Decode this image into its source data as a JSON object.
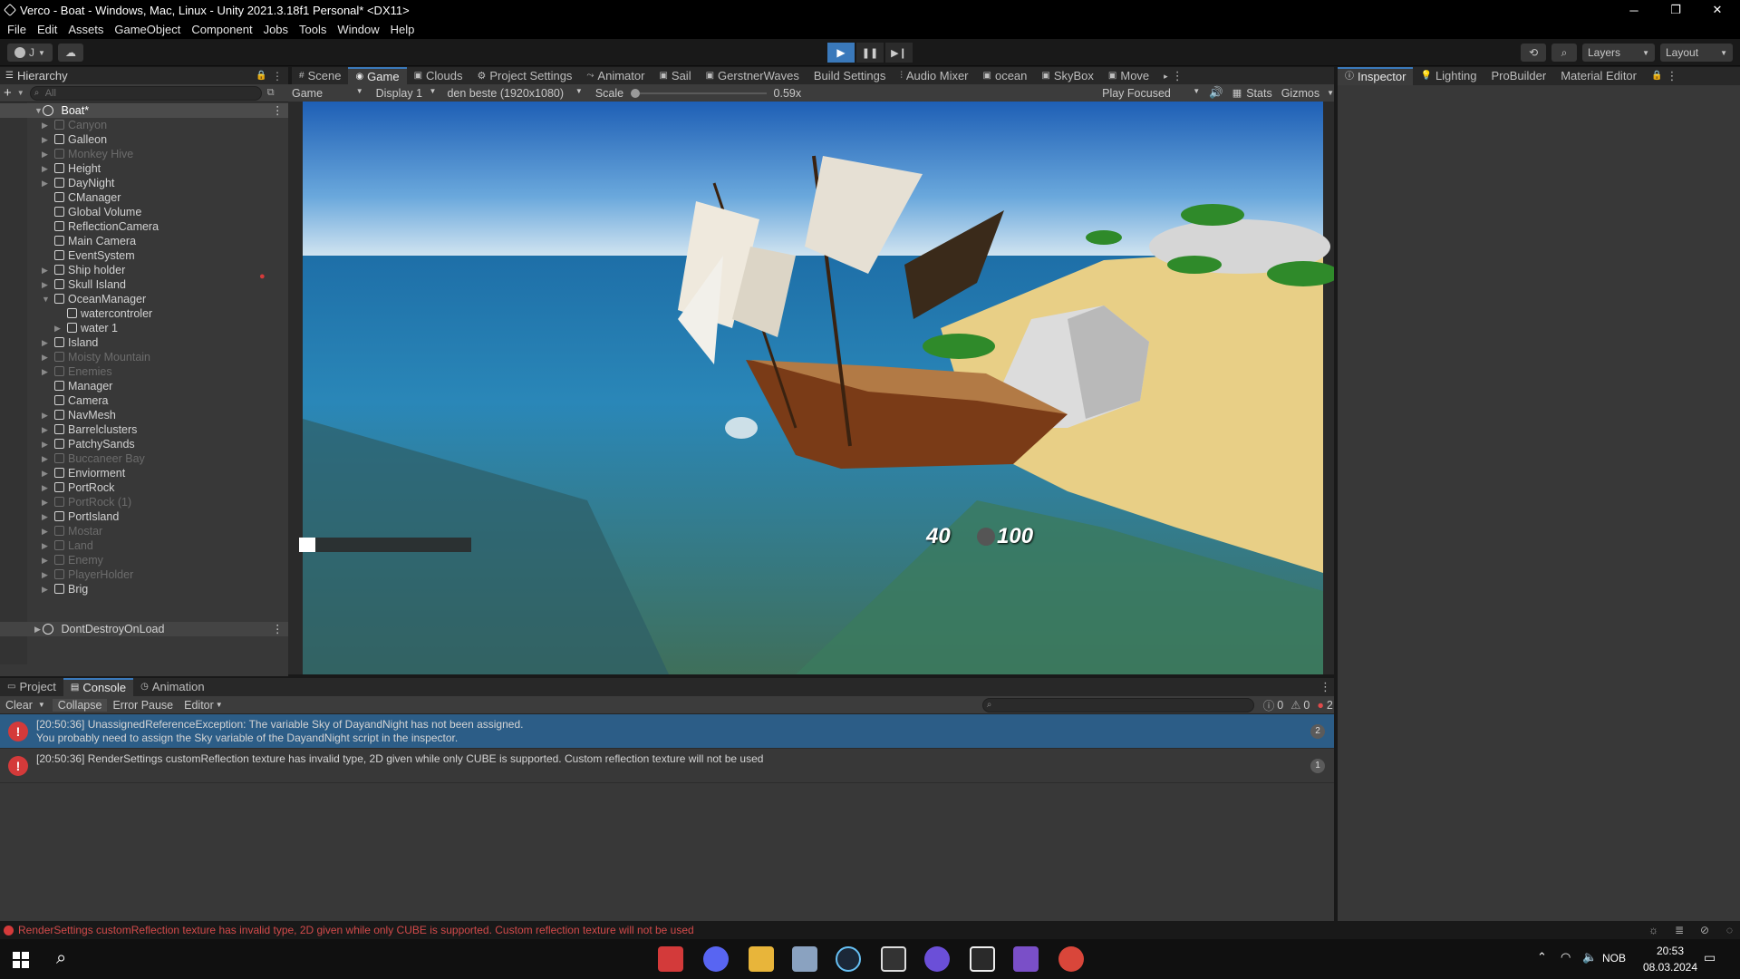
{
  "window": {
    "title": "Verco - Boat - Windows, Mac, Linux - Unity 2021.3.18f1 Personal* <DX11>",
    "minimize": "─",
    "restore": "❐",
    "close": "✕"
  },
  "menu": [
    "File",
    "Edit",
    "Assets",
    "GameObject",
    "Component",
    "Jobs",
    "Tools",
    "Window",
    "Help"
  ],
  "toolbar": {
    "account": "J",
    "layers": "Layers",
    "layout": "Layout"
  },
  "hierarchy": {
    "tab": "Hierarchy",
    "search_placeholder": "All",
    "scene": "Boat*",
    "items": [
      {
        "label": "Canyon",
        "dim": true
      },
      {
        "label": "Galleon",
        "dim": false
      },
      {
        "label": "Monkey Hive",
        "dim": true
      },
      {
        "label": "Height",
        "dim": false
      },
      {
        "label": "DayNight",
        "dim": false
      },
      {
        "label": "CManager",
        "dim": false
      },
      {
        "label": "Global Volume",
        "dim": false
      },
      {
        "label": "ReflectionCamera",
        "dim": false
      },
      {
        "label": "Main Camera",
        "dim": false
      },
      {
        "label": "EventSystem",
        "dim": false
      },
      {
        "label": "Ship holder",
        "dim": false
      },
      {
        "label": "Skull Island",
        "dim": false
      },
      {
        "label": "OceanManager",
        "dim": false
      },
      {
        "label": "watercontroler",
        "dim": false
      },
      {
        "label": "water 1",
        "dim": false
      },
      {
        "label": "Island",
        "dim": false
      },
      {
        "label": "Moisty Mountain",
        "dim": true
      },
      {
        "label": "Enemies",
        "dim": true
      },
      {
        "label": "Manager",
        "dim": false
      },
      {
        "label": "Camera",
        "dim": false
      },
      {
        "label": "NavMesh",
        "dim": false
      },
      {
        "label": "Barrelclusters",
        "dim": false
      },
      {
        "label": "PatchySands",
        "dim": false
      },
      {
        "label": "Buccaneer Bay",
        "dim": true
      },
      {
        "label": "Enviorment",
        "dim": false
      },
      {
        "label": "PortRock",
        "dim": false
      },
      {
        "label": "PortRock (1)",
        "dim": true
      },
      {
        "label": "PortIsland",
        "dim": false
      },
      {
        "label": "Mostar",
        "dim": true
      },
      {
        "label": "Land",
        "dim": true
      },
      {
        "label": "Enemy",
        "dim": true
      },
      {
        "label": "PlayerHolder",
        "dim": true
      },
      {
        "label": "Brig",
        "dim": false
      }
    ],
    "dontdestroy": "DontDestroyOnLoad"
  },
  "center_tabs": [
    "Scene",
    "Game",
    "Clouds",
    "Project Settings",
    "Animator",
    "Sail",
    "GerstnerWaves",
    "Build Settings",
    "Audio Mixer",
    "ocean",
    "SkyBox",
    "Move"
  ],
  "game": {
    "mode": "Game",
    "display": "Display 1",
    "resolution": "den beste (1920x1080)",
    "scale_label": "Scale",
    "scale_value": "0.59x",
    "play_focused": "Play Focused",
    "stats": "Stats",
    "gizmos": "Gizmos",
    "hud_left": "40",
    "hud_right": "100"
  },
  "right_tabs": [
    "Inspector",
    "Lighting",
    "ProBuilder",
    "Material Editor"
  ],
  "bottom_tabs": [
    "Project",
    "Console",
    "Animation"
  ],
  "console": {
    "clear": "Clear",
    "collapse": "Collapse",
    "error_pause": "Error Pause",
    "editor": "Editor",
    "info_count": "0",
    "warn_count": "0",
    "error_count": "2",
    "entries": [
      {
        "line1": "[20:50:36] UnassignedReferenceException: The variable Sky of DayandNight has not been assigned.",
        "line2": "You probably need to assign the Sky variable of the DayandNight script in the inspector.",
        "count": "2"
      },
      {
        "line1": "[20:50:36] RenderSettings customReflection texture has invalid type, 2D given while only CUBE is supported. Custom reflection texture will not be used",
        "line2": "",
        "count": "1"
      }
    ]
  },
  "statusbar": "RenderSettings customReflection texture has invalid type, 2D given while only CUBE is supported. Custom reflection texture will not be used",
  "taskbar": {
    "lang": "NOB",
    "time": "20:53",
    "date": "08.03.2024"
  }
}
